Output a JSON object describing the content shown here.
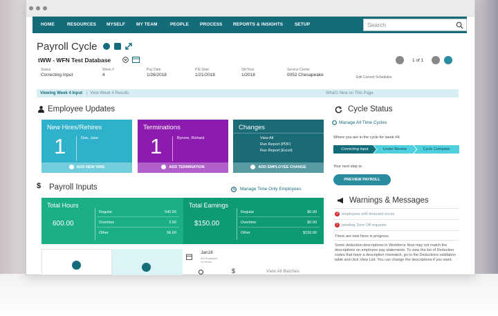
{
  "nav": {
    "items": [
      "HOME",
      "RESOURCES",
      "MYSELF",
      "MY TEAM",
      "PEOPLE",
      "PROCESS",
      "REPORTS & INSIGHTS",
      "SETUP"
    ],
    "search_placeholder": "Search"
  },
  "page": {
    "title": "Payroll Cycle",
    "subtitle": "tWW - WFN Test Database",
    "pager": "1 of 1",
    "meta": [
      {
        "label": "Status",
        "value": "Correcting Input"
      },
      {
        "label": "Week #",
        "value": "4"
      },
      {
        "label": "Pay Date",
        "value": "1/26/2018"
      },
      {
        "label": "P/E Date",
        "value": "1/21/2018"
      },
      {
        "label": "Qtr/Year",
        "value": "1/2018"
      },
      {
        "label": "Service Center",
        "value": "0052 Chesapeake"
      }
    ],
    "schedules_link": "Edit Current Schedules"
  },
  "banner": {
    "viewing": "Viewing Week 4 Input",
    "results_link": "View Week 4 Results",
    "whats_new": "What's New on This Page"
  },
  "employee_updates": {
    "title": "Employee Updates",
    "new_hires": {
      "title": "New Hires/Rehires",
      "count": "1",
      "name": "Doe, Jane",
      "action": "ADD NEW HIRE"
    },
    "terminations": {
      "title": "Terminations",
      "count": "1",
      "name": "Bynore, Richard",
      "action": "ADD TERMINATION"
    },
    "changes": {
      "title": "Changes",
      "links": [
        "View All",
        "Run Report (PDF)",
        "Run Report (Excel)"
      ],
      "action": "ADD EMPLOYEE CHANGE"
    }
  },
  "payroll_inputs": {
    "title": "Payroll Inputs",
    "manage_link": "Manage Time Only Employees",
    "hours": {
      "title": "Total Hours",
      "total": "600.00",
      "rows": [
        {
          "label": "Regular",
          "value": "540.50"
        },
        {
          "label": "Overtime",
          "value": "3.50"
        },
        {
          "label": "Other",
          "value": "56.00"
        }
      ]
    },
    "earnings": {
      "title": "Total Earnings",
      "total": "$150.00",
      "rows": [
        {
          "label": "Regular",
          "value": "$0.00"
        },
        {
          "label": "Overtime",
          "value": "$0.00"
        },
        {
          "label": "Other",
          "value": "$150.00"
        }
      ]
    },
    "batch": {
      "date": "Jan18",
      "line1": "4/4 Employee",
      "line2": "10 Hours"
    },
    "view_batches": "View All Batches"
  },
  "cycle_status": {
    "title": "Cycle Status",
    "manage_link": "Manage All Time Cycles",
    "where_text": "Where you are in the cycle for week #4:",
    "steps": [
      "Correcting Input",
      "Under Review",
      "Cycle Complete"
    ],
    "next_step": "Your next step is:",
    "preview_button": "PREVIEW PAYROLL"
  },
  "warnings": {
    "title": "Warnings & Messages",
    "items": [
      {
        "count": "3",
        "text": "employees with timecard errors"
      },
      {
        "count": "1",
        "text": "pending Time Off requests"
      }
    ],
    "messages": [
      "There are new hires in progress.",
      "Some deduction descriptions in Workforce Now may not match the descriptions on employee pay statements. To view the list of Deduction codes that have a description mismatch, go to the Deductions validation table and click View List. You can change the descriptions if you want."
    ]
  },
  "colors": {
    "nav": "#146b7a",
    "cyan": "#2fb1cc",
    "purple": "#8d1bb0",
    "teal_dark": "#1a6b76",
    "green": "#1aaf86",
    "green_dark": "#0e9a74",
    "step_active": "#146b7a",
    "step_next": "#4fd0de"
  }
}
